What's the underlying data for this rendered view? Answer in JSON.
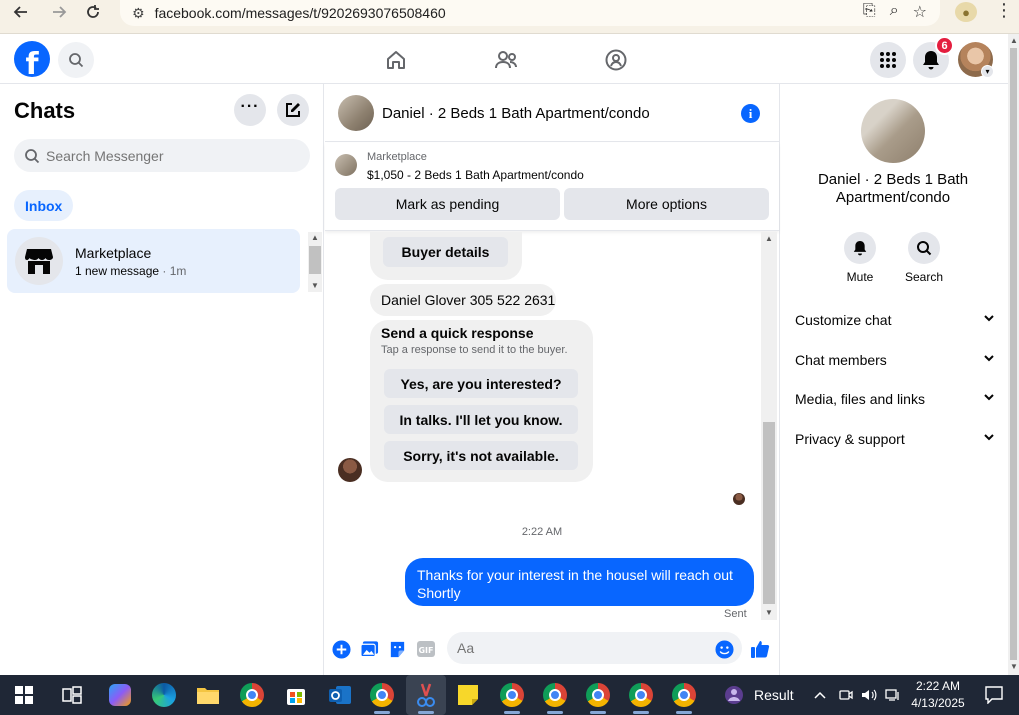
{
  "browser": {
    "url": "facebook.com/messages/t/9202693076508460"
  },
  "header": {
    "logo": "f",
    "notifications_count": "6"
  },
  "left": {
    "title": "Chats",
    "search_placeholder": "Search Messenger",
    "inbox_label": "Inbox",
    "chats": [
      {
        "name": "Marketplace",
        "preview": "1 new message",
        "time": "1m"
      }
    ]
  },
  "conversation": {
    "title": "Daniel · 2 Beds 1 Bath Apartment/condo",
    "marketplace_label": "Marketplace",
    "listing": "$1,050 - 2 Beds 1 Bath Apartment/condo",
    "mark_pending": "Mark as pending",
    "more_options": "More options",
    "buyer_details": "Buyer details",
    "contact_message": "Daniel Glover 305 522 2631",
    "quick_title": "Send a quick response",
    "quick_sub": "Tap a response to send it to the buyer.",
    "quick_replies": [
      "Yes, are you interested?",
      "In talks. I'll let you know.",
      "Sorry, it's not available."
    ],
    "timestamp": "2:22 AM",
    "sent_message": "Thanks for your interest in the housel will reach out Shortly",
    "sent_label": "Sent",
    "composer_placeholder": "Aa"
  },
  "right": {
    "name": "Daniel · 2 Beds 1 Bath Apartment/condo",
    "mute": "Mute",
    "search": "Search",
    "sections": [
      "Customize chat",
      "Chat members",
      "Media, files and links",
      "Privacy & support"
    ]
  },
  "taskbar": {
    "result_label": "Result",
    "time": "2:22 AM",
    "date": "4/13/2025"
  },
  "colors": {
    "brand": "#0866ff",
    "badge": "#e41e3f",
    "selected": "#e7f0fd",
    "taskbar": "#1f2736"
  }
}
